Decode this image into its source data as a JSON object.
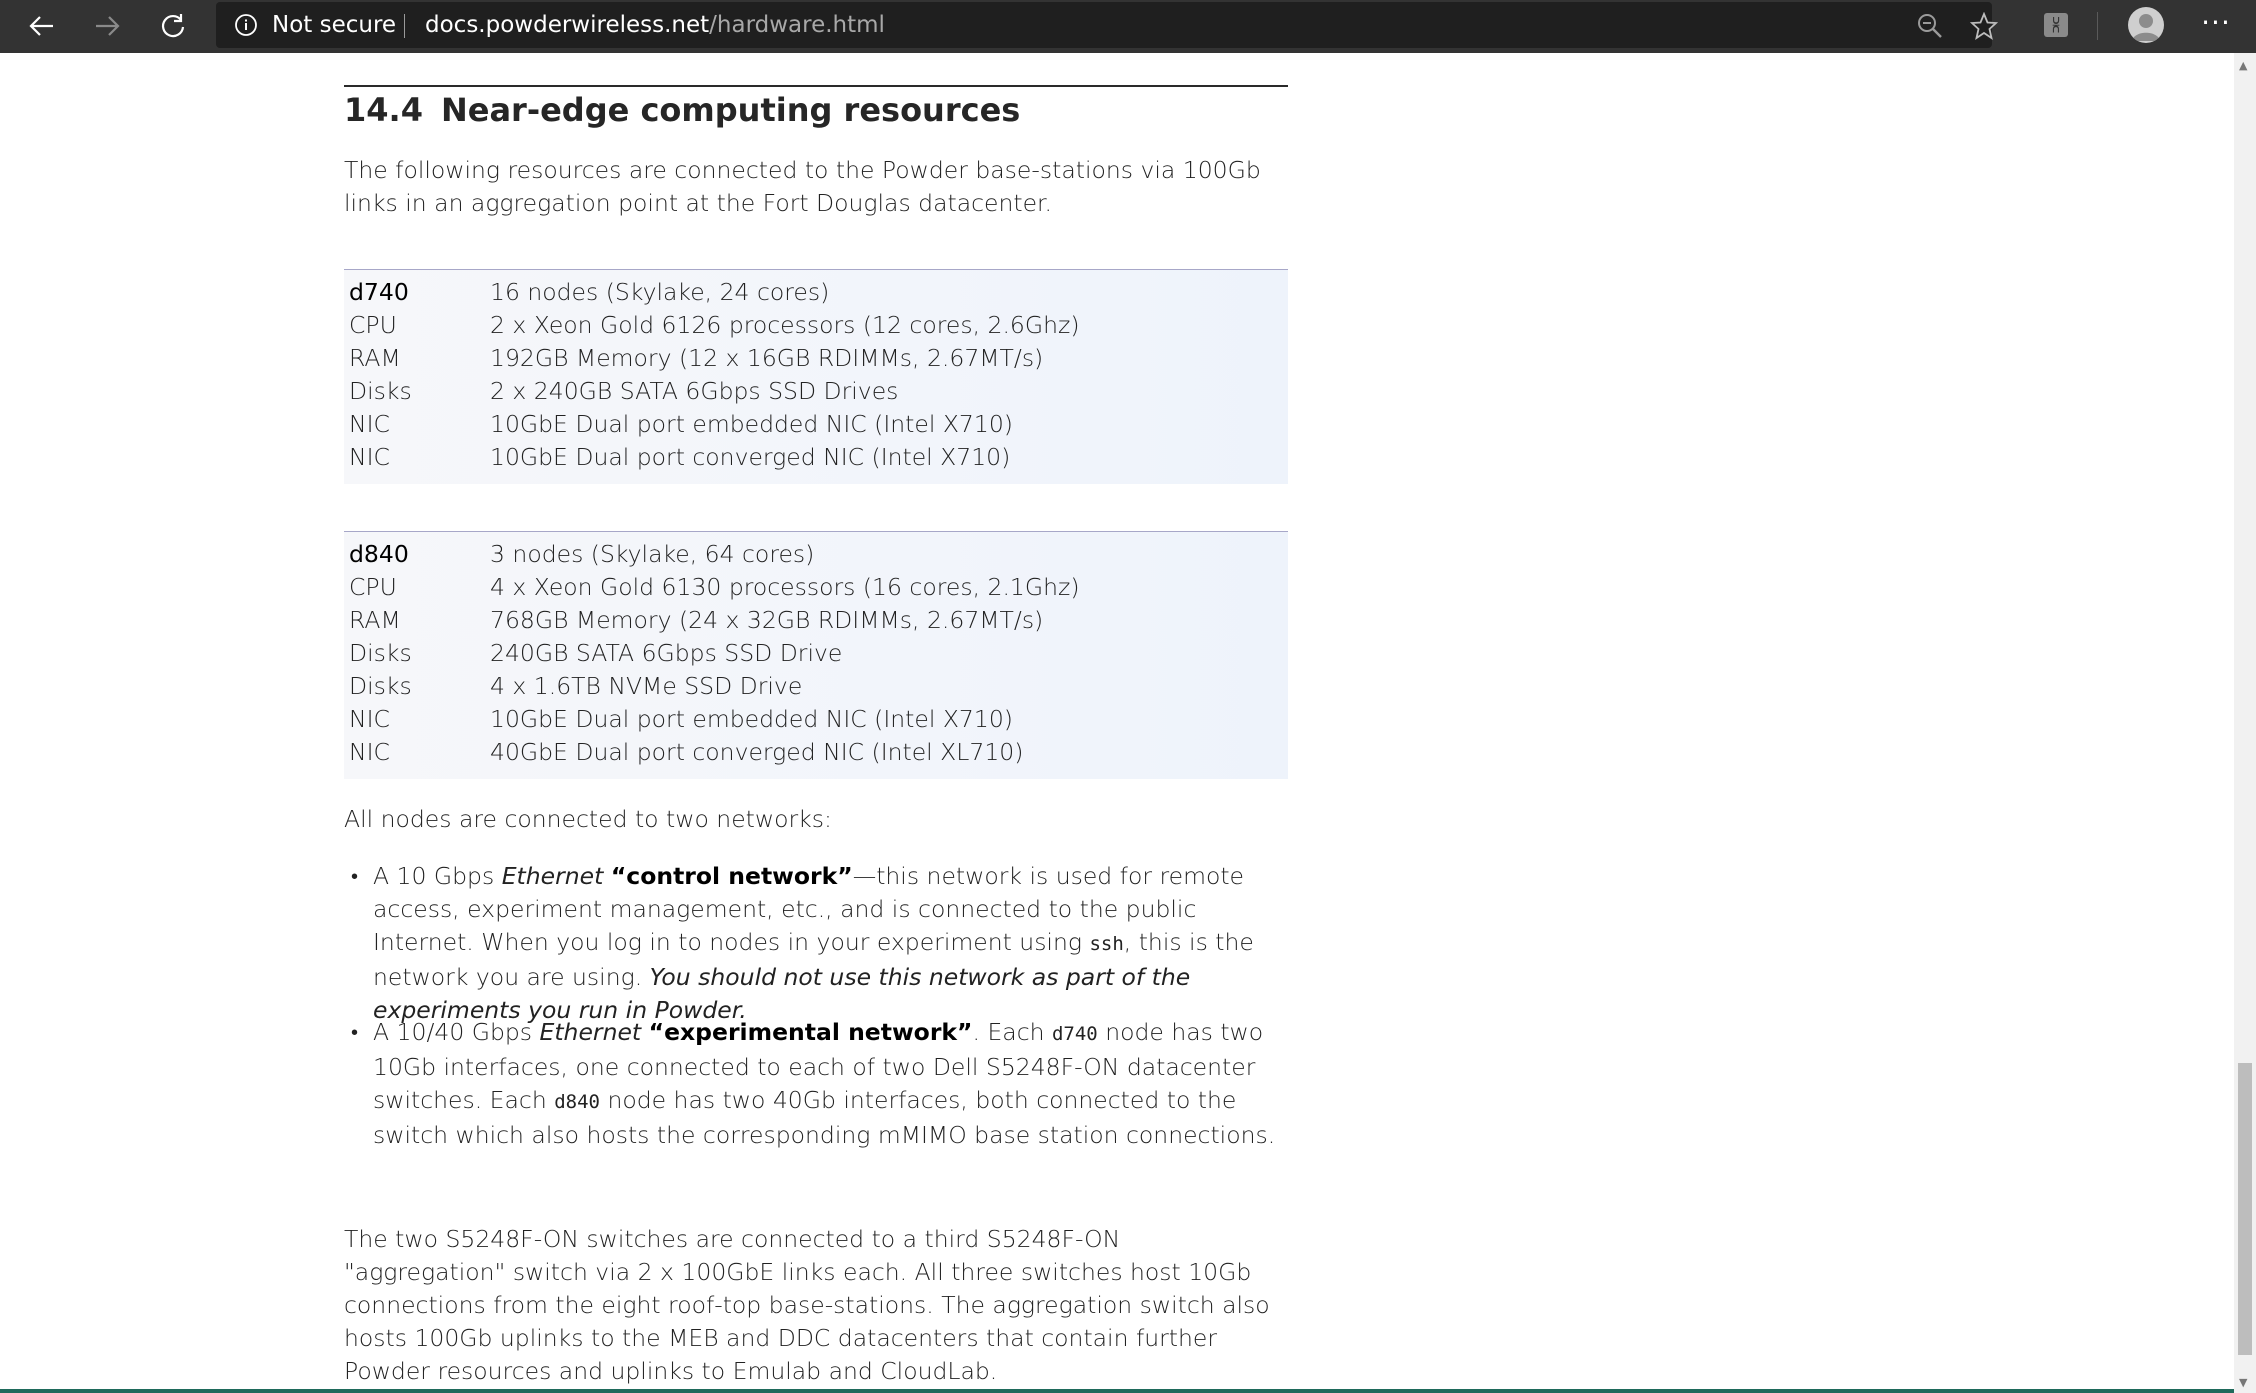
{
  "browser": {
    "security_label": "Not secure",
    "url_host": "docs.powderwireless.net",
    "url_path": "/hardware.html",
    "icons": [
      "back-icon",
      "forward-icon",
      "refresh-icon",
      "info-icon",
      "zoom-icon",
      "star-icon",
      "extension-icon",
      "avatar",
      "more-icon"
    ],
    "extension_glyph": "⩈",
    "more_glyph": "···"
  },
  "section": {
    "number": "14.4",
    "title": "Near-edge computing resources",
    "intro": "The following resources are connected to the Powder base-stations via 100Gb links in an aggregation point at the Fort Douglas datacenter."
  },
  "tables": [
    {
      "rows": [
        {
          "key": "d740",
          "value": "16 nodes (Skylake, 24 cores)"
        },
        {
          "key": "CPU",
          "value": "2 x Xeon Gold 6126 processors (12 cores, 2.6Ghz)"
        },
        {
          "key": "RAM",
          "value": "192GB Memory (12 x 16GB RDIMMs, 2.67MT/s)"
        },
        {
          "key": "Disks",
          "value": "2 x 240GB SATA 6Gbps SSD Drives"
        },
        {
          "key": "NIC",
          "value": "10GbE Dual port embedded NIC (Intel X710)"
        },
        {
          "key": "NIC",
          "value": "10GbE Dual port converged NIC (Intel X710)"
        }
      ]
    },
    {
      "rows": [
        {
          "key": "d840",
          "value": "3 nodes (Skylake, 64 cores)"
        },
        {
          "key": "CPU",
          "value": "4 x Xeon Gold 6130 processors (16 cores, 2.1Ghz)"
        },
        {
          "key": "RAM",
          "value": "768GB Memory (24 x 32GB RDIMMs, 2.67MT/s)"
        },
        {
          "key": "Disks",
          "value": "240GB SATA 6Gbps SSD Drive"
        },
        {
          "key": "Disks",
          "value": "4 x 1.6TB NVMe SSD Drive"
        },
        {
          "key": "NIC",
          "value": "10GbE Dual port embedded NIC (Intel X710)"
        },
        {
          "key": "NIC",
          "value": "40GbE Dual port converged NIC (Intel XL710)"
        }
      ]
    }
  ],
  "networks_intro": "All nodes are connected to two networks:",
  "bullets": [
    {
      "b1_pre": "A 10 Gbps ",
      "b1_em": "Ethernet",
      "b1_space": " ",
      "b1_strong": "“control network”",
      "b1_mid": "—this network is used for remote access, experiment management, etc., and is connected to the public Internet. When you log in to nodes in your experiment using ",
      "b1_code": "ssh",
      "b1_post": ", this is the network you are using. ",
      "b1_em2": "You should not use this network as part of the experiments you run in Powder."
    },
    {
      "b2_pre": "A 10/40 Gbps ",
      "b2_em": "Ethernet",
      "b2_space": " ",
      "b2_strong": "“experimental network”",
      "b2_mid1": ". Each ",
      "b2_code1": "d740",
      "b2_mid2": " node has two 10Gb interfaces, one connected to each of two Dell S5248F-ON datacenter switches. Each ",
      "b2_code2": "d840",
      "b2_post": " node has two 40Gb interfaces, both connected to the switch which also hosts the corresponding mMIMO base station connections."
    }
  ],
  "closing": "The two S5248F-ON switches are connected to a third S5248F-ON \"aggregation\" switch via 2 x 100GbE links each. All three switches host 10Gb connections from the eight roof-top base-stations. The aggregation switch also hosts 100Gb uplinks to the MEB and DDC datacenters that contain further Powder resources and uplinks to Emulab and CloudLab."
}
